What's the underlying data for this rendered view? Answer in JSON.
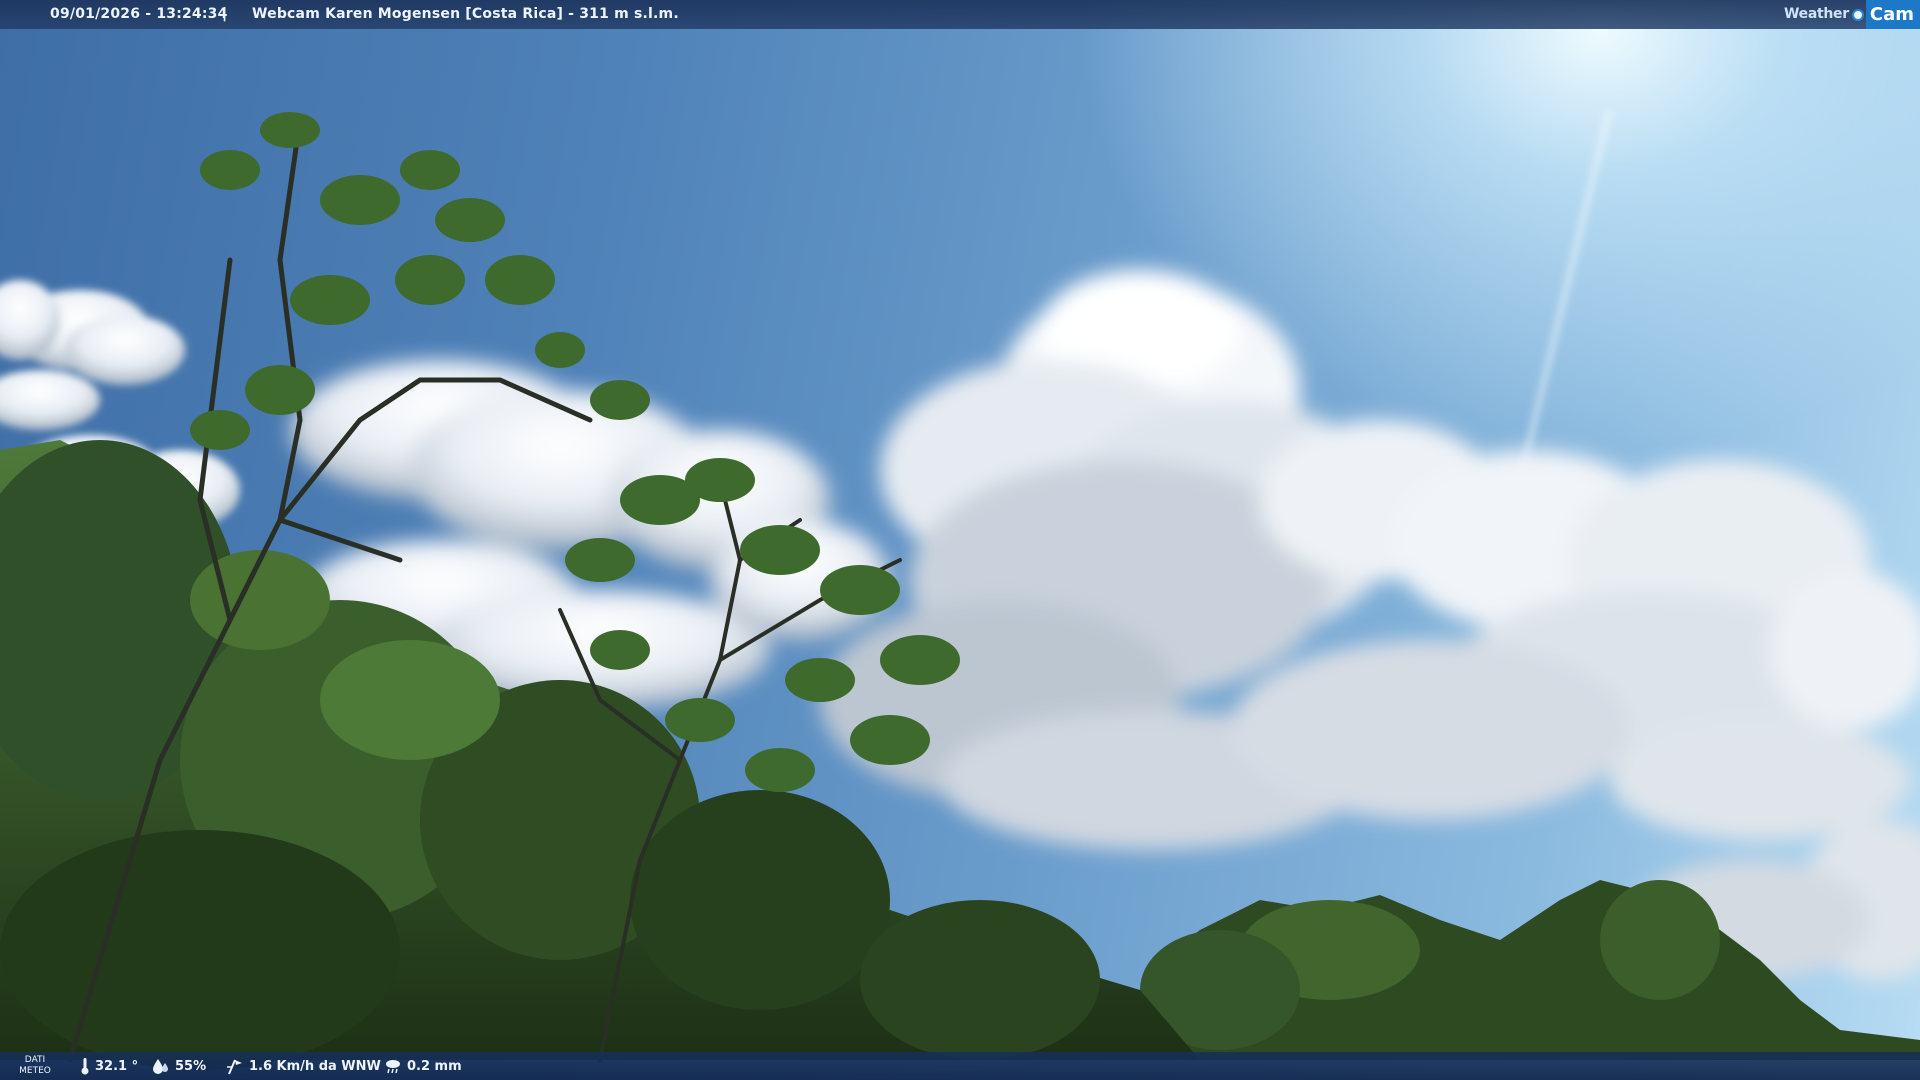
{
  "header": {
    "datetime": "09/01/2026 - 13:24:34",
    "separator": "|",
    "title": "Webcam Karen Mogensen [Costa Rica] - 311 m s.l.m."
  },
  "logo": {
    "word1": "Weather",
    "word2": "Cam",
    "icon": "sun-dot-icon"
  },
  "weather_bar": {
    "label_line1": "DATI",
    "label_line2": "METEO",
    "temperature": "32.1 °",
    "humidity": "55%",
    "wind": "1.6 Km/h da WNW",
    "rain": "0.2 mm",
    "icons": {
      "temperature": "thermometer-icon",
      "humidity": "humidity-drops-icon",
      "wind": "wind-vane-icon",
      "rain": "rain-cloud-icon"
    }
  },
  "colors": {
    "bar_bg": "#1c345c",
    "bar_text": "#eef4fb",
    "logo_accent": "#1d78c8",
    "sky_light": "#b7dcf3",
    "sky_dark": "#3f6ea6",
    "foliage": "#2f4a22"
  }
}
